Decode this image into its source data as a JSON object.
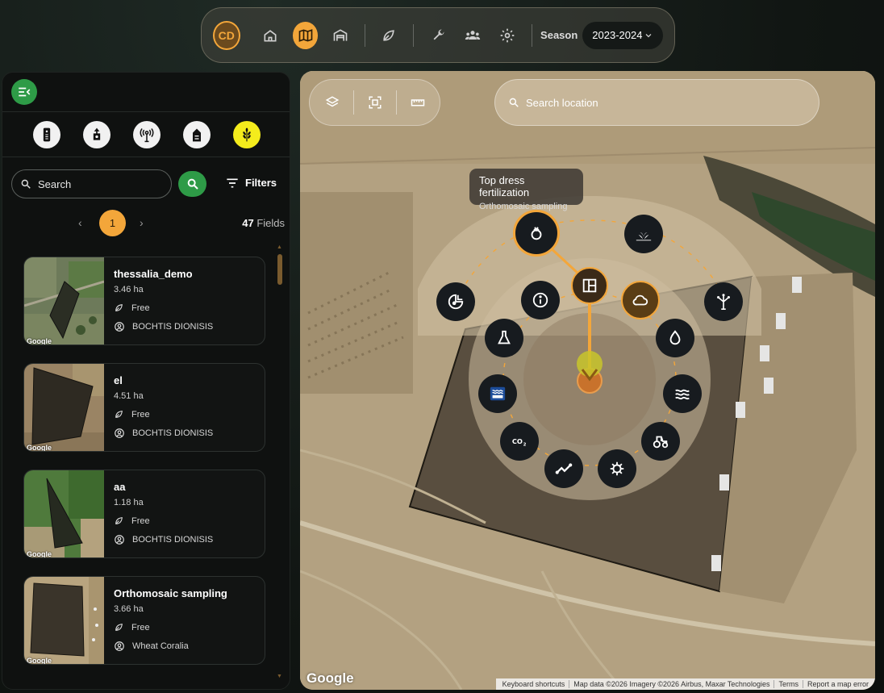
{
  "topbar": {
    "avatar_initials": "CD",
    "nav": [
      {
        "icon": "home-icon",
        "active": false
      },
      {
        "icon": "map-icon",
        "active": true
      },
      {
        "icon": "barn-icon",
        "active": false
      },
      {
        "icon": "leaf-icon",
        "active": false
      },
      {
        "icon": "wrench-icon",
        "active": false
      },
      {
        "icon": "users-icon",
        "active": false
      },
      {
        "icon": "gear-icon",
        "active": false
      }
    ],
    "season_label": "Season",
    "season_value": "2023-2024"
  },
  "sidebar": {
    "categories": [
      {
        "icon": "sensor-device-icon",
        "active": false
      },
      {
        "icon": "tractor-drone-icon",
        "active": false
      },
      {
        "icon": "weather-station-icon",
        "active": false
      },
      {
        "icon": "silo-icon",
        "active": false
      },
      {
        "icon": "wheat-icon",
        "active": true
      }
    ],
    "search_placeholder": "Search",
    "filters_label": "Filters",
    "pager": {
      "current": "1",
      "count_number": "47",
      "count_label": "Fields"
    },
    "fields": [
      {
        "name": "thessalia_demo",
        "area": "3.46 ha",
        "status": "Free",
        "owner": "BOCHTIS DIONISIS",
        "thumb_label": "Google"
      },
      {
        "name": "el",
        "area": "4.51 ha",
        "status": "Free",
        "owner": "BOCHTIS DIONISIS",
        "thumb_label": "Google"
      },
      {
        "name": "aa",
        "area": "1.18 ha",
        "status": "Free",
        "owner": "BOCHTIS DIONISIS",
        "thumb_label": "Google"
      },
      {
        "name": "Orthomosaic sampling",
        "area": "3.66 ha",
        "status": "Free",
        "owner": "Wheat Coralia",
        "thumb_label": "Google"
      }
    ]
  },
  "map": {
    "search_placeholder": "Search location",
    "tools": [
      "layers-icon",
      "fit-bounds-icon",
      "ruler-icon"
    ],
    "tooltip": {
      "title": "Top dress fertilization",
      "subtitle": "Orthomosaic sampling"
    },
    "google_logo": "Google",
    "attribution": [
      "Keyboard shortcuts",
      "Map data ©2026 Imagery ©2026 Airbus, Maxar Technologies",
      "Terms",
      "Report a map error"
    ],
    "accent": "#f3a63a"
  }
}
